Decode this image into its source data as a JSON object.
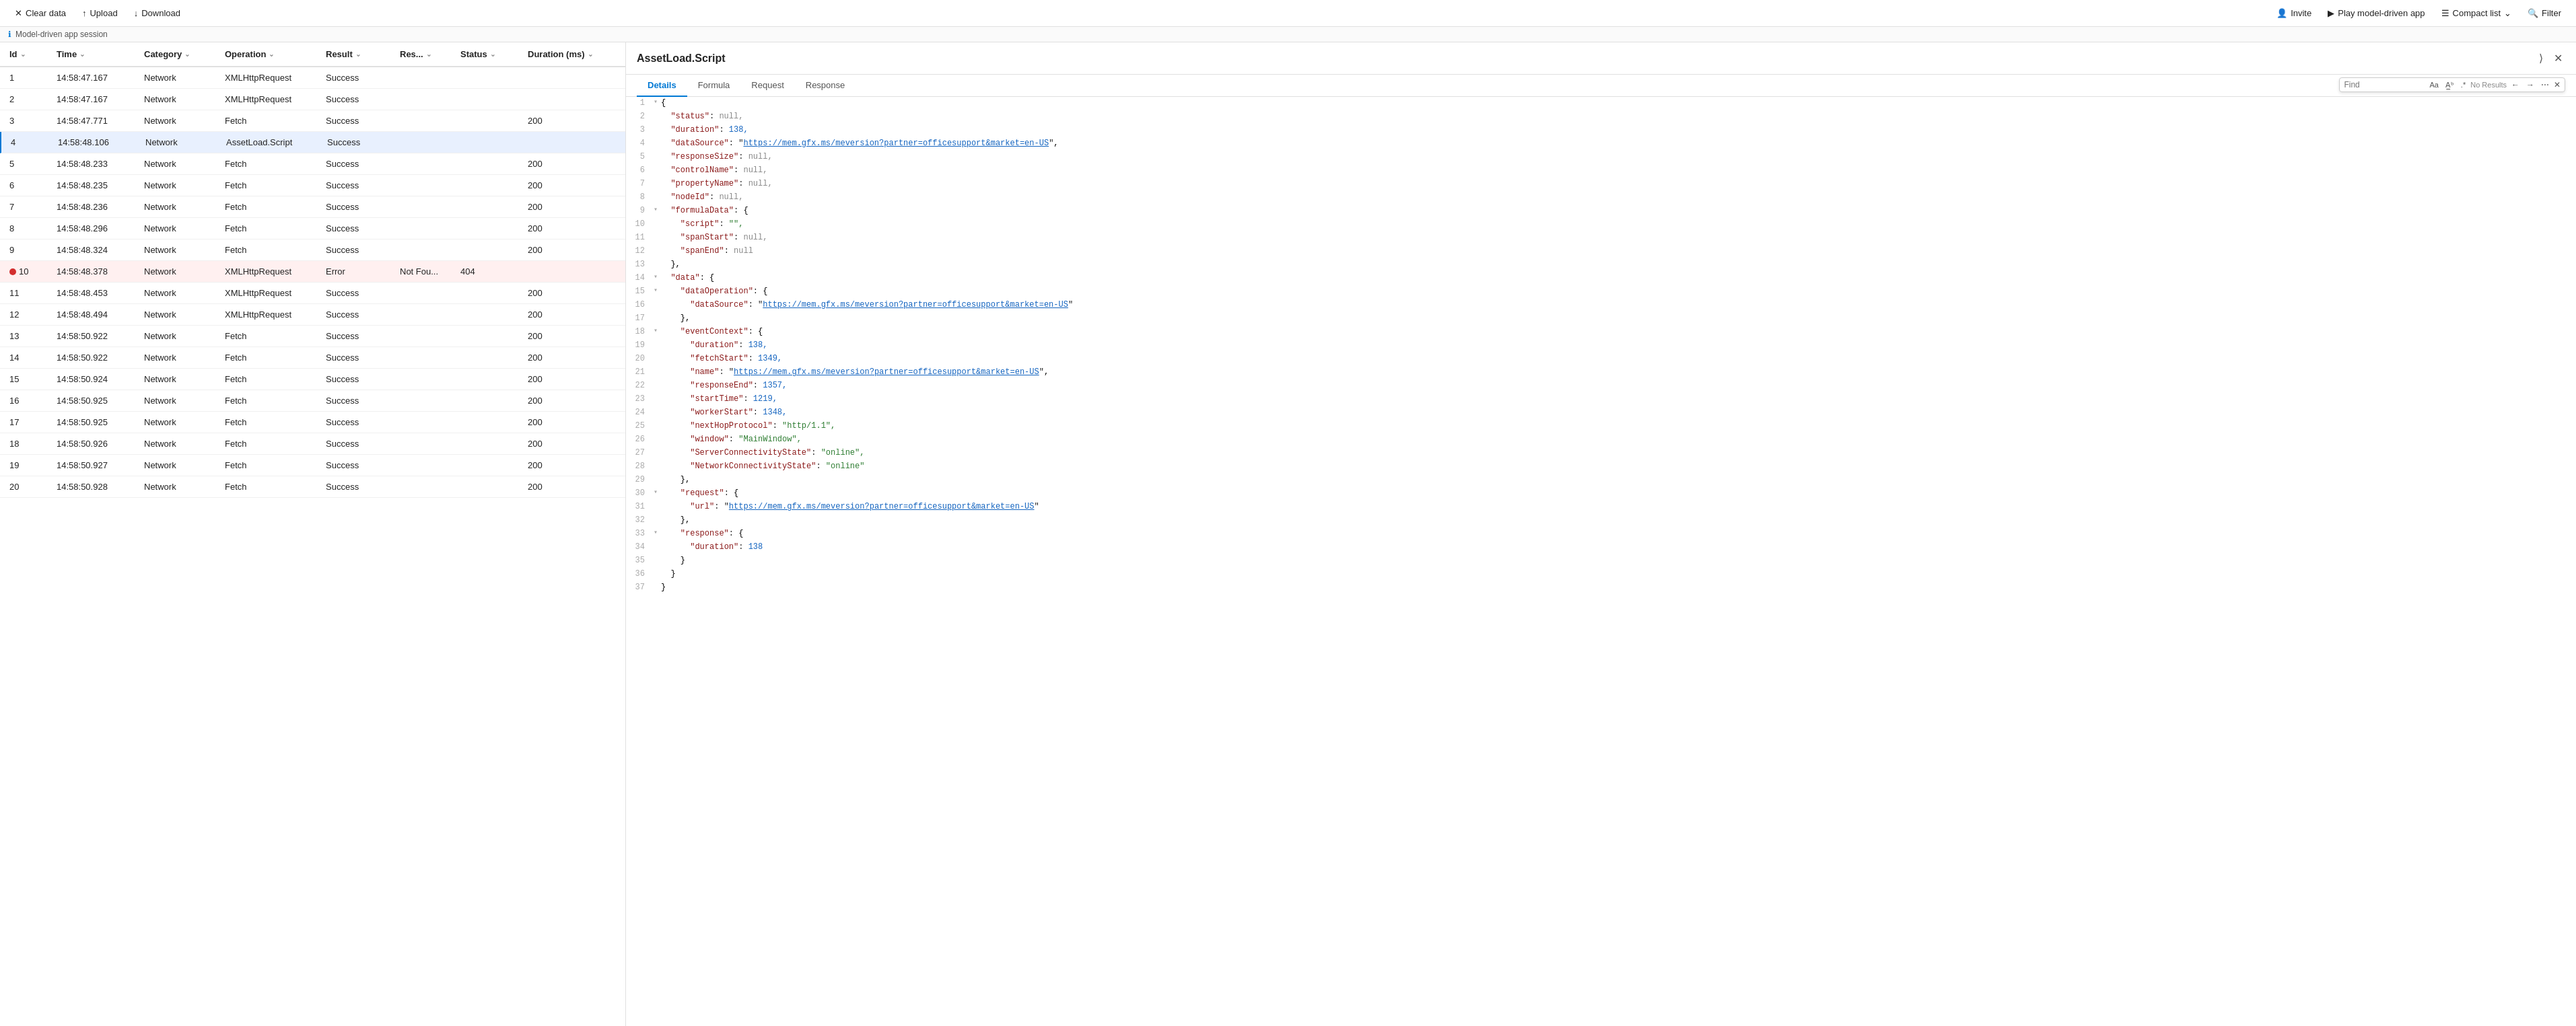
{
  "toolbar": {
    "clear_data_label": "Clear data",
    "upload_label": "Upload",
    "download_label": "Download",
    "invite_label": "Invite",
    "play_label": "Play model-driven app",
    "compact_list_label": "Compact list",
    "filter_label": "Filter"
  },
  "session_bar": {
    "label": "Model-driven app session"
  },
  "table": {
    "columns": [
      "Id",
      "Time",
      "Category",
      "Operation",
      "Result",
      "Res...",
      "Status",
      "Duration (ms)"
    ],
    "rows": [
      {
        "id": 1,
        "time": "14:58:47.167",
        "category": "Network",
        "operation": "XMLHttpRequest",
        "result": "Success",
        "res": "",
        "status": "",
        "duration": "",
        "error": false,
        "selected": false
      },
      {
        "id": 2,
        "time": "14:58:47.167",
        "category": "Network",
        "operation": "XMLHttpRequest",
        "result": "Success",
        "res": "",
        "status": "",
        "duration": "",
        "error": false,
        "selected": false
      },
      {
        "id": 3,
        "time": "14:58:47.771",
        "category": "Network",
        "operation": "Fetch",
        "result": "Success",
        "res": "",
        "status": "",
        "duration": "200",
        "error": false,
        "selected": false
      },
      {
        "id": 4,
        "time": "14:58:48.106",
        "category": "Network",
        "operation": "AssetLoad.Script",
        "result": "Success",
        "res": "",
        "status": "",
        "duration": "",
        "error": false,
        "selected": true
      },
      {
        "id": 5,
        "time": "14:58:48.233",
        "category": "Network",
        "operation": "Fetch",
        "result": "Success",
        "res": "",
        "status": "",
        "duration": "200",
        "error": false,
        "selected": false
      },
      {
        "id": 6,
        "time": "14:58:48.235",
        "category": "Network",
        "operation": "Fetch",
        "result": "Success",
        "res": "",
        "status": "",
        "duration": "200",
        "error": false,
        "selected": false
      },
      {
        "id": 7,
        "time": "14:58:48.236",
        "category": "Network",
        "operation": "Fetch",
        "result": "Success",
        "res": "",
        "status": "",
        "duration": "200",
        "error": false,
        "selected": false
      },
      {
        "id": 8,
        "time": "14:58:48.296",
        "category": "Network",
        "operation": "Fetch",
        "result": "Success",
        "res": "",
        "status": "",
        "duration": "200",
        "error": false,
        "selected": false
      },
      {
        "id": 9,
        "time": "14:58:48.324",
        "category": "Network",
        "operation": "Fetch",
        "result": "Success",
        "res": "",
        "status": "",
        "duration": "200",
        "error": false,
        "selected": false
      },
      {
        "id": 10,
        "time": "14:58:48.378",
        "category": "Network",
        "operation": "XMLHttpRequest",
        "result": "Error",
        "res": "Not Fou...",
        "status": "404",
        "duration": "",
        "error": true,
        "selected": false
      },
      {
        "id": 11,
        "time": "14:58:48.453",
        "category": "Network",
        "operation": "XMLHttpRequest",
        "result": "Success",
        "res": "",
        "status": "",
        "duration": "200",
        "error": false,
        "selected": false
      },
      {
        "id": 12,
        "time": "14:58:48.494",
        "category": "Network",
        "operation": "XMLHttpRequest",
        "result": "Success",
        "res": "",
        "status": "",
        "duration": "200",
        "error": false,
        "selected": false
      },
      {
        "id": 13,
        "time": "14:58:50.922",
        "category": "Network",
        "operation": "Fetch",
        "result": "Success",
        "res": "",
        "status": "",
        "duration": "200",
        "error": false,
        "selected": false
      },
      {
        "id": 14,
        "time": "14:58:50.922",
        "category": "Network",
        "operation": "Fetch",
        "result": "Success",
        "res": "",
        "status": "",
        "duration": "200",
        "error": false,
        "selected": false
      },
      {
        "id": 15,
        "time": "14:58:50.924",
        "category": "Network",
        "operation": "Fetch",
        "result": "Success",
        "res": "",
        "status": "",
        "duration": "200",
        "error": false,
        "selected": false
      },
      {
        "id": 16,
        "time": "14:58:50.925",
        "category": "Network",
        "operation": "Fetch",
        "result": "Success",
        "res": "",
        "status": "",
        "duration": "200",
        "error": false,
        "selected": false
      },
      {
        "id": 17,
        "time": "14:58:50.925",
        "category": "Network",
        "operation": "Fetch",
        "result": "Success",
        "res": "",
        "status": "",
        "duration": "200",
        "error": false,
        "selected": false
      },
      {
        "id": 18,
        "time": "14:58:50.926",
        "category": "Network",
        "operation": "Fetch",
        "result": "Success",
        "res": "",
        "status": "",
        "duration": "200",
        "error": false,
        "selected": false
      },
      {
        "id": 19,
        "time": "14:58:50.927",
        "category": "Network",
        "operation": "Fetch",
        "result": "Success",
        "res": "",
        "status": "",
        "duration": "200",
        "error": false,
        "selected": false
      },
      {
        "id": 20,
        "time": "14:58:50.928",
        "category": "Network",
        "operation": "Fetch",
        "result": "Success",
        "res": "",
        "status": "",
        "duration": "200",
        "error": false,
        "selected": false
      }
    ]
  },
  "detail": {
    "title": "AssetLoad.Script",
    "close_icon": "✕",
    "expand_icon": "⟩",
    "tabs": [
      "Details",
      "Formula",
      "Request",
      "Response"
    ],
    "active_tab": "Details",
    "find": {
      "placeholder": "Find",
      "no_results": "No Results",
      "options": [
        "Aa",
        ".*",
        "A*"
      ]
    },
    "code": [
      {
        "line": 1,
        "foldable": true,
        "content": "{",
        "indent": 0
      },
      {
        "line": 2,
        "foldable": false,
        "content": "  \"status\": null,",
        "indent": 0
      },
      {
        "line": 3,
        "foldable": false,
        "content": "  \"duration\": 138,",
        "indent": 0
      },
      {
        "line": 4,
        "foldable": false,
        "content": "  \"dataSource\": \"https://mem.gfx.ms/meversion?partner=officesupport&market=en-US\",",
        "indent": 0,
        "url": "https://mem.gfx.ms/meversion?partner=officesupport&market=en-US"
      },
      {
        "line": 5,
        "foldable": false,
        "content": "  \"responseSize\": null,",
        "indent": 0
      },
      {
        "line": 6,
        "foldable": false,
        "content": "  \"controlName\": null,",
        "indent": 0
      },
      {
        "line": 7,
        "foldable": false,
        "content": "  \"propertyName\": null,",
        "indent": 0
      },
      {
        "line": 8,
        "foldable": false,
        "content": "  \"nodeId\": null,",
        "indent": 0
      },
      {
        "line": 9,
        "foldable": true,
        "content": "  \"formulaData\": {",
        "indent": 0
      },
      {
        "line": 10,
        "foldable": false,
        "content": "    \"script\": \"\",",
        "indent": 1
      },
      {
        "line": 11,
        "foldable": false,
        "content": "    \"spanStart\": null,",
        "indent": 1
      },
      {
        "line": 12,
        "foldable": false,
        "content": "    \"spanEnd\": null",
        "indent": 1
      },
      {
        "line": 13,
        "foldable": false,
        "content": "  },",
        "indent": 0
      },
      {
        "line": 14,
        "foldable": true,
        "content": "  \"data\": {",
        "indent": 0
      },
      {
        "line": 15,
        "foldable": true,
        "content": "    \"dataOperation\": {",
        "indent": 1
      },
      {
        "line": 16,
        "foldable": false,
        "content": "      \"dataSource\": \"https://mem.gfx.ms/meversion?partner=officesupport&market=en-US\"",
        "indent": 2,
        "url": "https://mem.gfx.ms/meversion?partner=officesupport&market=en-US"
      },
      {
        "line": 17,
        "foldable": false,
        "content": "    },",
        "indent": 1
      },
      {
        "line": 18,
        "foldable": true,
        "content": "    \"eventContext\": {",
        "indent": 1
      },
      {
        "line": 19,
        "foldable": false,
        "content": "      \"duration\": 138,",
        "indent": 2
      },
      {
        "line": 20,
        "foldable": false,
        "content": "      \"fetchStart\": 1349,",
        "indent": 2
      },
      {
        "line": 21,
        "foldable": false,
        "content": "      \"name\": \"https://mem.gfx.ms/meversion?partner=officesupport&market=en-US\",",
        "indent": 2,
        "url": "https://mem.gfx.ms/meversion?partner=officesupport&market=en-US"
      },
      {
        "line": 22,
        "foldable": false,
        "content": "      \"responseEnd\": 1357,",
        "indent": 2
      },
      {
        "line": 23,
        "foldable": false,
        "content": "      \"startTime\": 1219,",
        "indent": 2
      },
      {
        "line": 24,
        "foldable": false,
        "content": "      \"workerStart\": 1348,",
        "indent": 2
      },
      {
        "line": 25,
        "foldable": false,
        "content": "      \"nextHopProtocol\": \"http/1.1\",",
        "indent": 2
      },
      {
        "line": 26,
        "foldable": false,
        "content": "      \"window\": \"MainWindow\",",
        "indent": 2
      },
      {
        "line": 27,
        "foldable": false,
        "content": "      \"ServerConnectivityState\": \"online\",",
        "indent": 2
      },
      {
        "line": 28,
        "foldable": false,
        "content": "      \"NetworkConnectivityState\": \"online\"",
        "indent": 2
      },
      {
        "line": 29,
        "foldable": false,
        "content": "    },",
        "indent": 1
      },
      {
        "line": 30,
        "foldable": true,
        "content": "    \"request\": {",
        "indent": 1
      },
      {
        "line": 31,
        "foldable": false,
        "content": "      \"url\": \"https://mem.gfx.ms/meversion?partner=officesupport&market=en-US\"",
        "indent": 2,
        "url": "https://mem.gfx.ms/meversion?partner=officesupport&market=en-US"
      },
      {
        "line": 32,
        "foldable": false,
        "content": "    },",
        "indent": 1
      },
      {
        "line": 33,
        "foldable": true,
        "content": "    \"response\": {",
        "indent": 1
      },
      {
        "line": 34,
        "foldable": false,
        "content": "      \"duration\": 138",
        "indent": 2
      },
      {
        "line": 35,
        "foldable": false,
        "content": "    }",
        "indent": 1
      },
      {
        "line": 36,
        "foldable": false,
        "content": "  }",
        "indent": 0
      },
      {
        "line": 37,
        "foldable": false,
        "content": "}",
        "indent": 0
      }
    ]
  },
  "colors": {
    "accent": "#0078d4",
    "error": "#d32f2f",
    "error_bg": "#fff0f0",
    "selected_bg": "#e8f0fe"
  }
}
